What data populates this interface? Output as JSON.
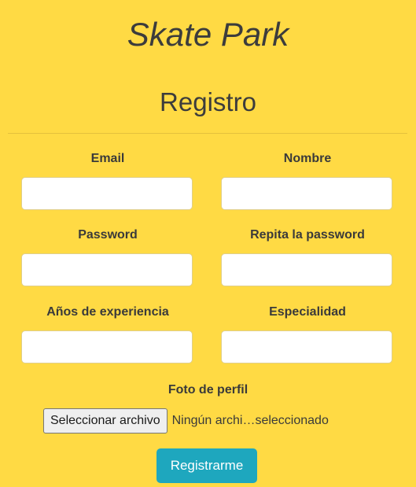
{
  "header": {
    "app_title": "Skate Park",
    "form_title": "Registro"
  },
  "form": {
    "fields": [
      {
        "label": "Email",
        "value": ""
      },
      {
        "label": "Nombre",
        "value": ""
      },
      {
        "label": "Password",
        "value": ""
      },
      {
        "label": "Repita la password",
        "value": ""
      },
      {
        "label": "Años de experiencia",
        "value": ""
      },
      {
        "label": "Especialidad",
        "value": ""
      }
    ],
    "photo": {
      "label": "Foto de perfil",
      "button_label": "Seleccionar archivo",
      "status_text": "Ningún archi…seleccionado"
    },
    "submit_label": "Registrarme"
  },
  "colors": {
    "background": "#ffda44",
    "submit_button": "#1ea7be",
    "text": "#3a3a3a"
  }
}
